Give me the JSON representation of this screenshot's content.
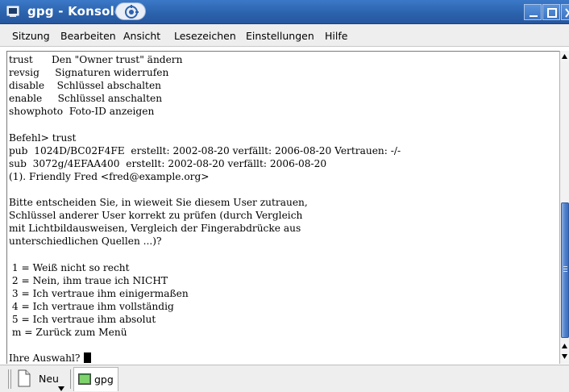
{
  "window": {
    "title": "gpg - Konsole",
    "app_icon": "konsole-icon",
    "deco_icon": "kde-gear-icon"
  },
  "menu": [
    "Sitzung",
    "Bearbeiten",
    "Ansicht",
    "Lesezeichen",
    "Einstellungen",
    "Hilfe"
  ],
  "terminal": {
    "lines": [
      "trust      Den \"Owner trust\" ändern",
      "revsig     Signaturen widerrufen",
      "disable    Schlüssel abschalten",
      "enable     Schlüssel anschalten",
      "showphoto  Foto-ID anzeigen",
      "",
      "Befehl> trust",
      "pub  1024D/BC02F4FE  erstellt: 2002-08-20 verfällt: 2006-08-20 Vertrauen: -/-",
      "sub  3072g/4EFAA400  erstellt: 2002-08-20 verfällt: 2006-08-20",
      "(1). Friendly Fred <fred@example.org>",
      "",
      "Bitte entscheiden Sie, in wieweit Sie diesem User zutrauen,",
      "Schlüssel anderer User korrekt zu prüfen (durch Vergleich",
      "mit Lichtbildausweisen, Vergleich der Fingerabdrücke aus",
      "unterschiedlichen Quellen ...)?",
      "",
      " 1 = Weiß nicht so recht",
      " 2 = Nein, ihm traue ich NICHT",
      " 3 = Ich vertraue ihm einigermaßen",
      " 4 = Ich vertraue ihm vollständig",
      " 5 = Ich vertraue ihm absolut",
      " m = Zurück zum Menü",
      "",
      "Ihre Auswahl? "
    ]
  },
  "tabs": {
    "new_label": "Neu",
    "session_label": "gpg"
  },
  "colors": {
    "titlebar": "#2c63ad",
    "scroll_thumb": "#4f82cf"
  }
}
